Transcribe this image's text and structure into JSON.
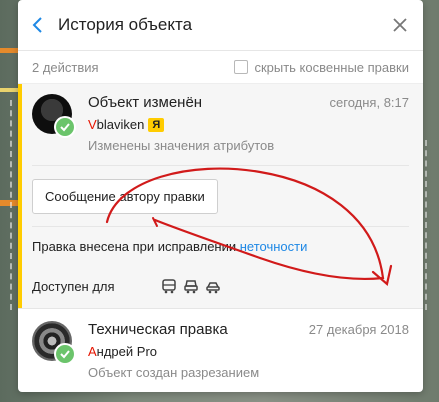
{
  "panel": {
    "title": "История объекта",
    "actions_count": "2 действия",
    "hide_indirect_label": "скрыть косвенные правки"
  },
  "entries": [
    {
      "title": "Объект изменён",
      "date": "сегодня, 8:17",
      "author_first": "V",
      "author_rest": "blaviken",
      "author_badge": "Я",
      "description": "Изменены значения атрибутов",
      "message_button": "Сообщение автору правки",
      "fix_text": "Правка внесена при исправлении ",
      "fix_link": "неточности",
      "available_for": "Доступен для",
      "vehicles": [
        "bus-icon",
        "truck-icon",
        "car-icon"
      ]
    },
    {
      "title": "Техническая правка",
      "date": "27 декабря 2018",
      "author_first": "А",
      "author_rest": "ндрей Pro",
      "description": "Объект создан разрезанием"
    }
  ],
  "colors": {
    "accent_yellow": "#ffcc00",
    "link_blue": "#1e88e5",
    "check_green": "#6bc46b",
    "scribble_red": "#d11a1a"
  }
}
